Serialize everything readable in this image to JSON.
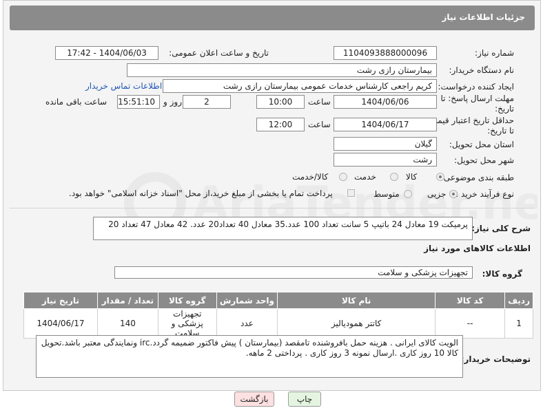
{
  "header": {
    "title": "جزئیات اطلاعات نیاز"
  },
  "form": {
    "need_number_label": "شماره نیاز:",
    "need_number": "1104093888000096",
    "announce_label": "تاریخ و ساعت اعلان عمومی:",
    "announce_value": "1404/06/03 - 17:42",
    "buyer_org_label": "نام دستگاه خریدار:",
    "buyer_org": "بیمارستان رازی رشت",
    "creator_label": "ایجاد کننده درخواست:",
    "creator": "کریم راجعی کارشناس خدمات عمومی بیمارستان رازی رشت",
    "contact_link": "اطلاعات تماس خریدار",
    "reply_deadline_label_1": "مهلت ارسال پاسخ: تا",
    "reply_deadline_label_2": "تاریخ:",
    "reply_date": "1404/06/06",
    "time_label": "ساعت",
    "reply_time": "10:00",
    "days_value": "2",
    "days_label": "روز و",
    "remaining_time": "15:51:10",
    "remaining_label": "ساعت باقی مانده",
    "price_validity_label_1": "حداقل تاریخ اعتبار قیمت:",
    "price_validity_label_2": "تا تاریخ:",
    "price_date": "1404/06/17",
    "price_time": "12:00",
    "province_label": "استان محل تحویل:",
    "province": "گیلان",
    "city_label": "شهر محل تحویل:",
    "city": "رشت",
    "category_label": "طبقه بندی موضوعی:",
    "category_options": [
      "کالا",
      "خدمت",
      "کالا/خدمت"
    ],
    "process_label": "نوع فرآیند خرید :",
    "process_options": [
      "جزیی",
      "متوسط"
    ],
    "payment_note": "پرداخت تمام یا بخشی از مبلغ خرید،از محل \"اسناد خزانه اسلامی\" خواهد بود."
  },
  "summary": {
    "label": "شرح کلی نیاز:",
    "text": "پرمیکت 19 معادل 24  باتیپ 5 سانت  تعداد 100 عدد.35 معادل 40 تعداد20 عدد. 42 معادل 47 تعداد 20"
  },
  "goods": {
    "section_title": "اطلاعات کالاهای مورد نیاز",
    "group_label": "گروه کالا:",
    "group_value": "تجهیزات پزشکی و سلامت",
    "columns": [
      "ردیف",
      "کد کالا",
      "نام کالا",
      "واحد شمارش",
      "گروه کالا",
      "تعداد / مقدار",
      "تاریخ نیاز"
    ],
    "rows": [
      {
        "row": "1",
        "code": "--",
        "name": "کاتتر همودیالیز",
        "unit": "عدد",
        "group": "تجهیزات پزشکی و سلامت",
        "qty": "140",
        "date": "1404/06/17"
      }
    ]
  },
  "buyer_notes": {
    "label": "توضیحات خریدار:",
    "text": "الویت کالای ایرانی . هزینه حمل بافروشنده تامقصد (بیمارستان ) پیش فاکتور ضمیمه گردد.irc ونمایندگی معتبر باشد.تحویل کالا 10 روز کاری .ارسال نمونه 3 روز کاری . پرداختی 2 ماهه."
  },
  "buttons": {
    "print": "چاپ",
    "back": "بازگشت"
  },
  "watermark": {
    "text": "AriaTender.neT"
  },
  "colors": {
    "header_bg": "#8b8b8b",
    "link": "#1f57b5",
    "back_button": "#fde0e0",
    "print_button": "#e4f4e0"
  }
}
